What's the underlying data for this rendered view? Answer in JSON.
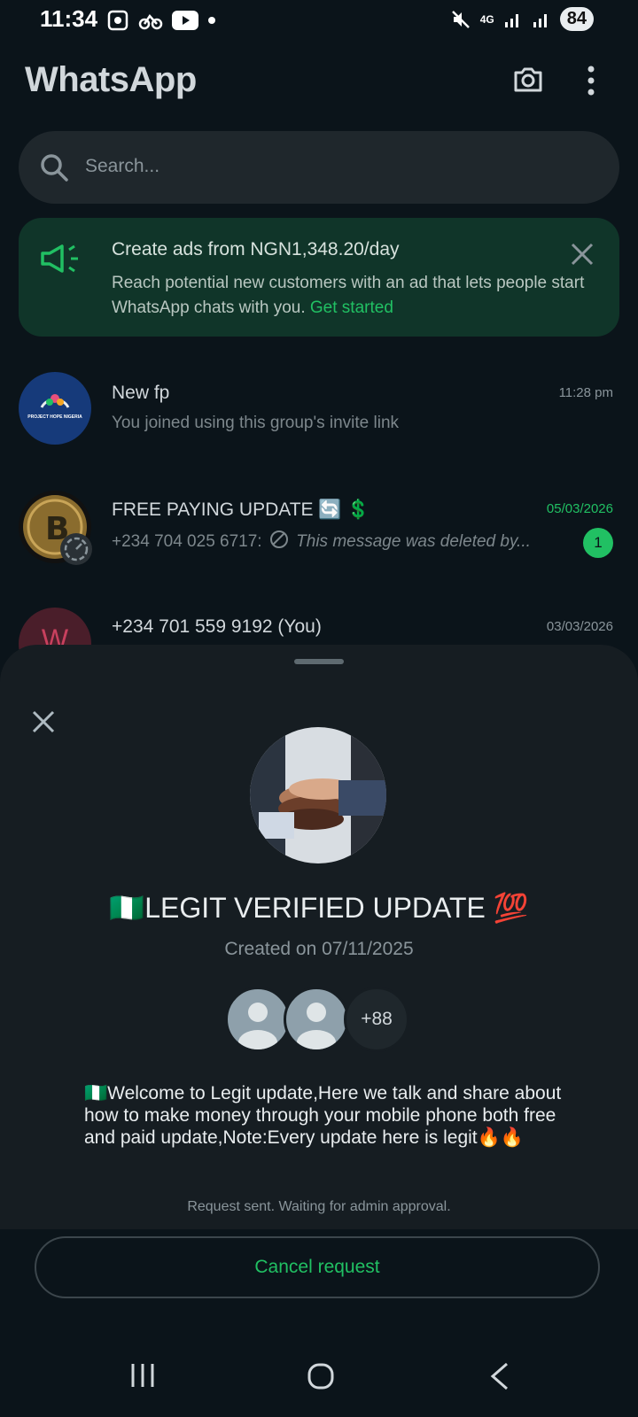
{
  "status_bar": {
    "time": "11:34",
    "network": "4G",
    "battery": "84"
  },
  "header": {
    "title": "WhatsApp"
  },
  "search": {
    "placeholder": "Search..."
  },
  "ad": {
    "title": "Create ads from NGN1,348.20/day",
    "text": "Reach potential new customers with an ad that lets people start WhatsApp chats with you.",
    "link": "Get started"
  },
  "chats": [
    {
      "name": "New fp",
      "message": "You joined using this group's invite link",
      "time": "11:28 pm",
      "avatar_text": "PROJECT HOPE NIGERIA"
    },
    {
      "name": "FREE PAYING UPDATE 🔄 💲",
      "sender": "+234 704 025 6717:",
      "message": "This message was deleted by...",
      "time": "05/03/2026",
      "unread": "1",
      "time_color": "#21c063"
    },
    {
      "name": "+234 701 559 9192 (You)",
      "time": "03/03/2026",
      "avatar_letter": "W"
    }
  ],
  "sheet": {
    "group_name": "🇳🇬LEGIT VERIFIED UPDATE 💯",
    "created": "Created on 07/11/2025",
    "member_count": "+88",
    "description": "🇳🇬Welcome to Legit update,Here we talk and share about how to make money through your mobile phone both free and paid update,Note:Every update here is legit🔥🔥",
    "status_note": "Request sent. Waiting for admin approval.",
    "cancel_label": "Cancel request"
  },
  "colors": {
    "accent": "#21c063",
    "background": "#0b141a",
    "sheet": "#161d22",
    "ad_bg": "#103529"
  }
}
